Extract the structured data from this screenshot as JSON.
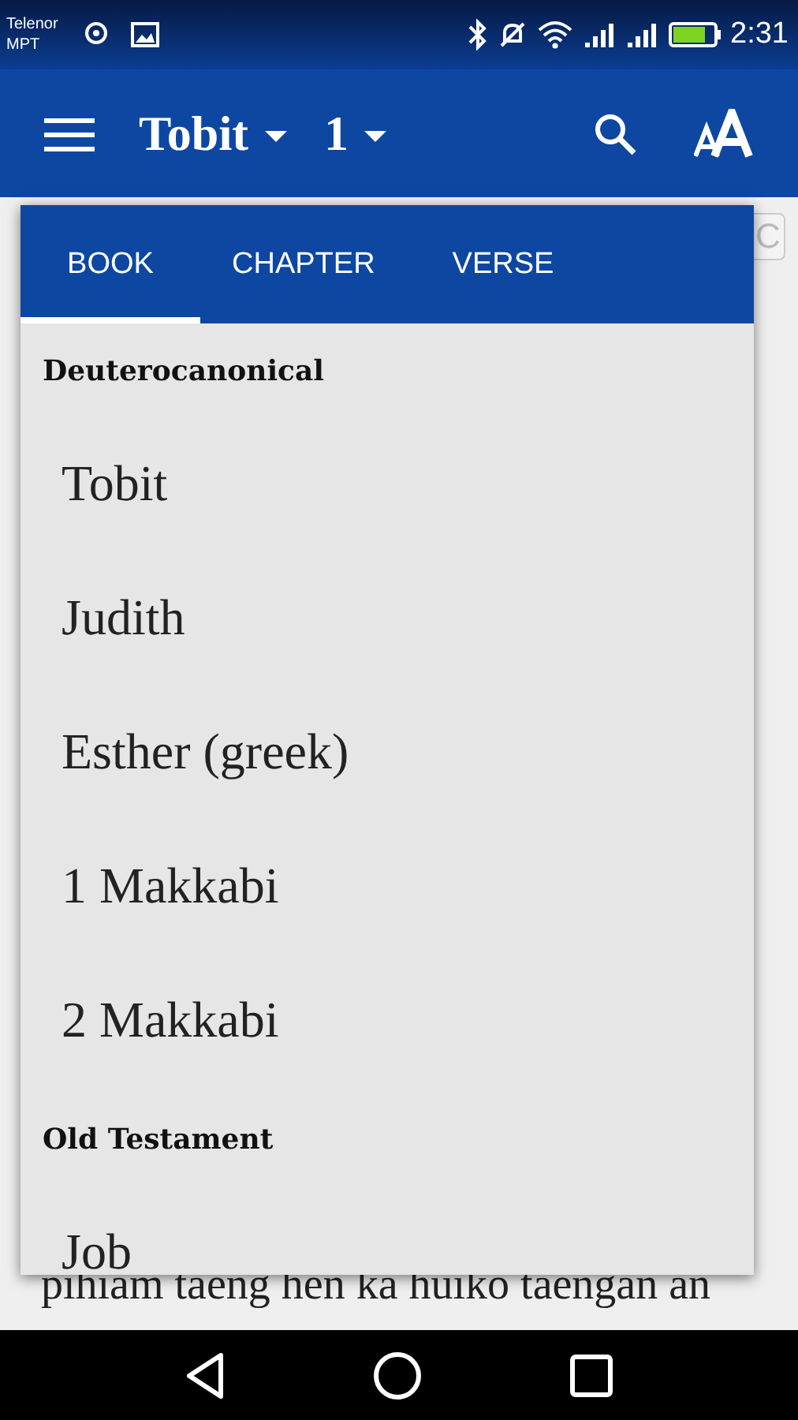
{
  "status_bar": {
    "carrier": [
      "Telenor",
      "MPT"
    ],
    "time": "2:31"
  },
  "app_bar": {
    "book": "Tobit",
    "chapter": "1"
  },
  "reader": {
    "visible_line": "pihiam taeng hen ka huiko taengan an",
    "side_button": "C"
  },
  "picker": {
    "tabs": [
      {
        "label": "BOOK",
        "selected": true
      },
      {
        "label": "CHAPTER",
        "selected": false
      },
      {
        "label": "VERSE",
        "selected": false
      }
    ],
    "groups": [
      {
        "title": "Deuterocanonical",
        "books": [
          "Tobit",
          "Judith",
          "Esther (greek)",
          "1 Makkabi",
          "2 Makkabi"
        ]
      },
      {
        "title": "Old Testament",
        "books": [
          "Job"
        ]
      }
    ]
  }
}
